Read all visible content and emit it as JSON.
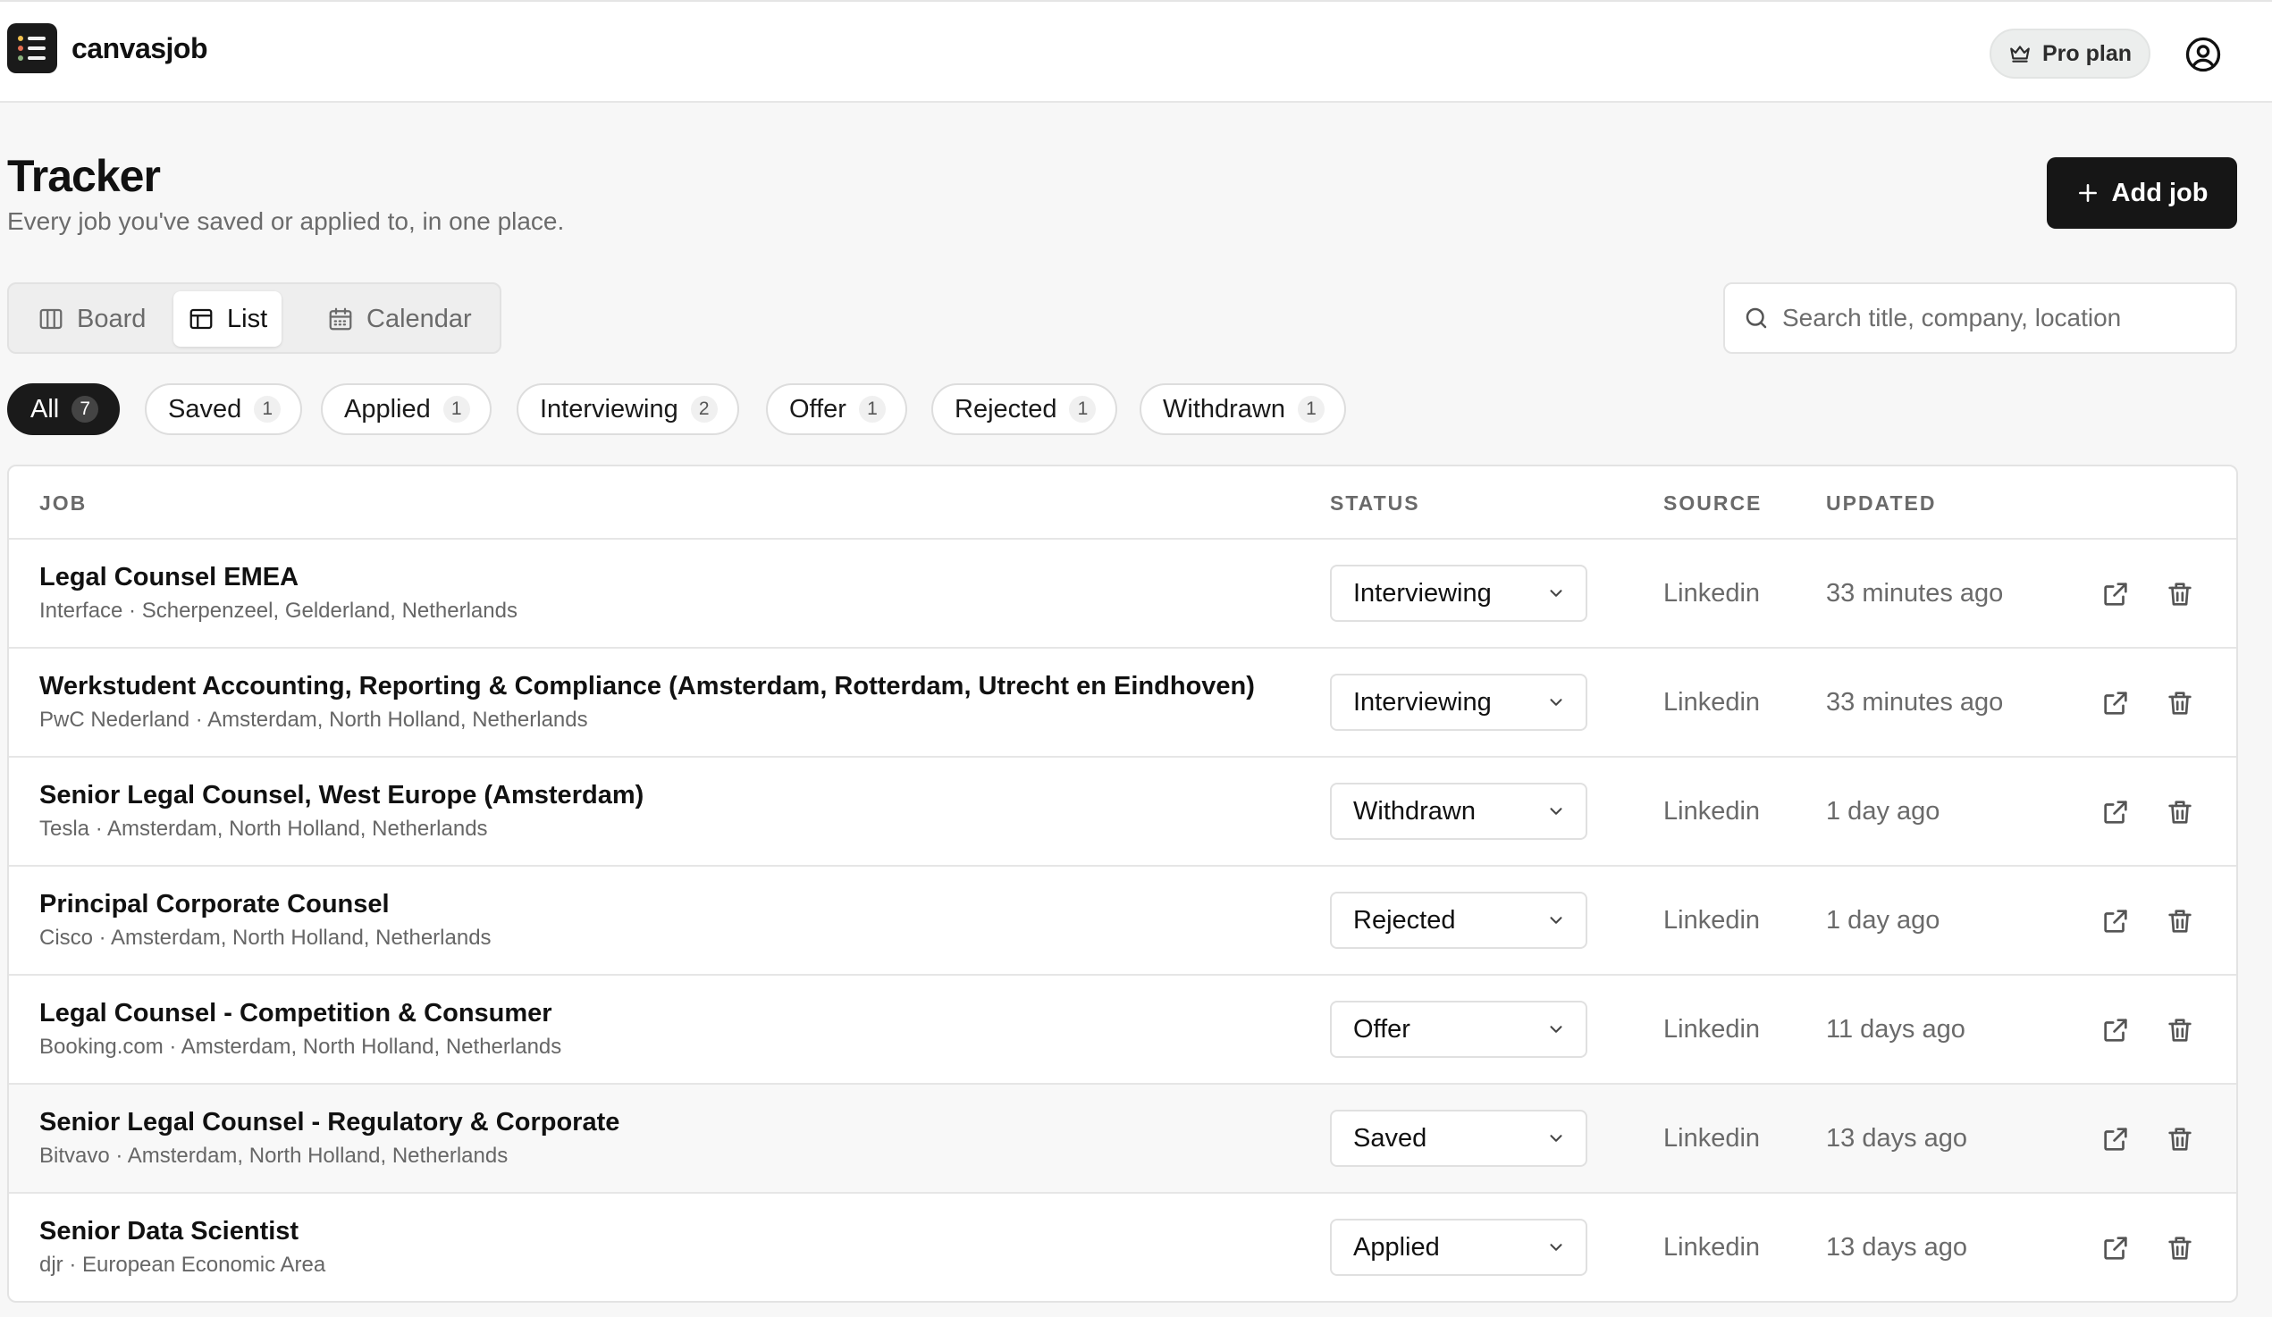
{
  "app": {
    "brand": "canvasjob",
    "pro_plan_label": "Pro plan"
  },
  "page": {
    "title": "Tracker",
    "subtitle": "Every job you've saved or applied to, in one place.",
    "add_job_label": "Add job"
  },
  "views": [
    {
      "label": "Board",
      "icon": "board-icon",
      "active": false
    },
    {
      "label": "List",
      "icon": "list-icon",
      "active": true
    },
    {
      "label": "Calendar",
      "icon": "calendar-icon",
      "active": false
    }
  ],
  "search": {
    "placeholder": "Search title, company, location",
    "value": ""
  },
  "filters": [
    {
      "label": "All",
      "count": "7",
      "active": true
    },
    {
      "label": "Saved",
      "count": "1",
      "active": false
    },
    {
      "label": "Applied",
      "count": "1",
      "active": false
    },
    {
      "label": "Interviewing",
      "count": "2",
      "active": false
    },
    {
      "label": "Offer",
      "count": "1",
      "active": false
    },
    {
      "label": "Rejected",
      "count": "1",
      "active": false
    },
    {
      "label": "Withdrawn",
      "count": "1",
      "active": false
    }
  ],
  "table": {
    "headers": {
      "job": "JOB",
      "status": "STATUS",
      "source": "SOURCE",
      "updated": "UPDATED"
    },
    "rows": [
      {
        "title": "Legal Counsel EMEA",
        "meta": "Interface · Scherpenzeel, Gelderland, Netherlands",
        "status": "Interviewing",
        "source": "Linkedin",
        "updated": "33 minutes ago"
      },
      {
        "title": "Werkstudent Accounting, Reporting & Compliance (Amsterdam, Rotterdam, Utrecht en Eindhoven)",
        "meta": "PwC Nederland · Amsterdam, North Holland, Netherlands",
        "status": "Interviewing",
        "source": "Linkedin",
        "updated": "33 minutes ago"
      },
      {
        "title": "Senior Legal Counsel, West Europe (Amsterdam)",
        "meta": "Tesla · Amsterdam, North Holland, Netherlands",
        "status": "Withdrawn",
        "source": "Linkedin",
        "updated": "1 day ago"
      },
      {
        "title": "Principal Corporate Counsel",
        "meta": "Cisco · Amsterdam, North Holland, Netherlands",
        "status": "Rejected",
        "source": "Linkedin",
        "updated": "1 day ago"
      },
      {
        "title": "Legal Counsel - Competition & Consumer",
        "meta": "Booking.com · Amsterdam, North Holland, Netherlands",
        "status": "Offer",
        "source": "Linkedin",
        "updated": "11 days ago"
      },
      {
        "title": "Senior Legal Counsel - Regulatory & Corporate",
        "meta": "Bitvavo · Amsterdam, North Holland, Netherlands",
        "status": "Saved",
        "source": "Linkedin",
        "updated": "13 days ago"
      },
      {
        "title": "Senior Data Scientist",
        "meta": "djr · European Economic Area",
        "status": "Applied",
        "source": "Linkedin",
        "updated": "13 days ago"
      }
    ]
  },
  "colors": {
    "primary_button": "#161616",
    "page_background": "#f7f7f7",
    "muted_text": "#6a6a6a"
  }
}
